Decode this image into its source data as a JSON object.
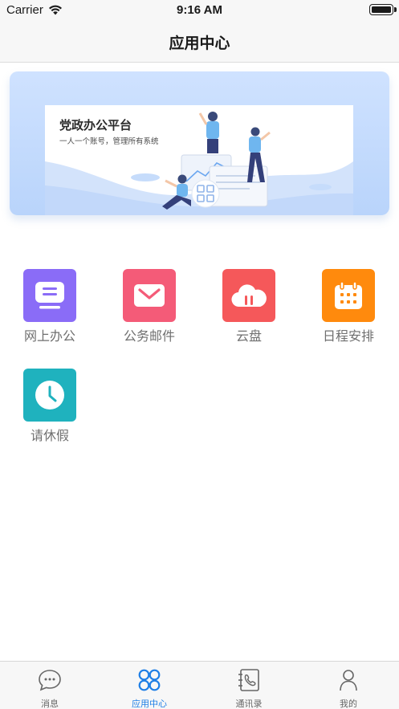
{
  "status_bar": {
    "carrier": "Carrier",
    "time": "9:16 AM"
  },
  "nav": {
    "title": "应用中心"
  },
  "banner": {
    "title": "党政办公平台",
    "subtitle": "一人一个账号，管理所有系统"
  },
  "apps": [
    {
      "label": "网上办公",
      "color": "#8a6cf7",
      "icon": "document-icon"
    },
    {
      "label": "公务邮件",
      "color": "#f45b78",
      "icon": "mail-icon"
    },
    {
      "label": "云盘",
      "color": "#f5585a",
      "icon": "cloud-icon"
    },
    {
      "label": "日程安排",
      "color": "#ff8a0d",
      "icon": "calendar-icon"
    },
    {
      "label": "请休假",
      "color": "#1fb2be",
      "icon": "clock-icon"
    }
  ],
  "tabs": [
    {
      "label": "消息",
      "icon": "chat-icon",
      "active": false
    },
    {
      "label": "应用中心",
      "icon": "apps-icon",
      "active": true
    },
    {
      "label": "通讯录",
      "icon": "contacts-icon",
      "active": false
    },
    {
      "label": "我的",
      "icon": "profile-icon",
      "active": false
    }
  ],
  "colors": {
    "active_tab": "#1f7fe6",
    "inactive_tab": "#666666"
  }
}
